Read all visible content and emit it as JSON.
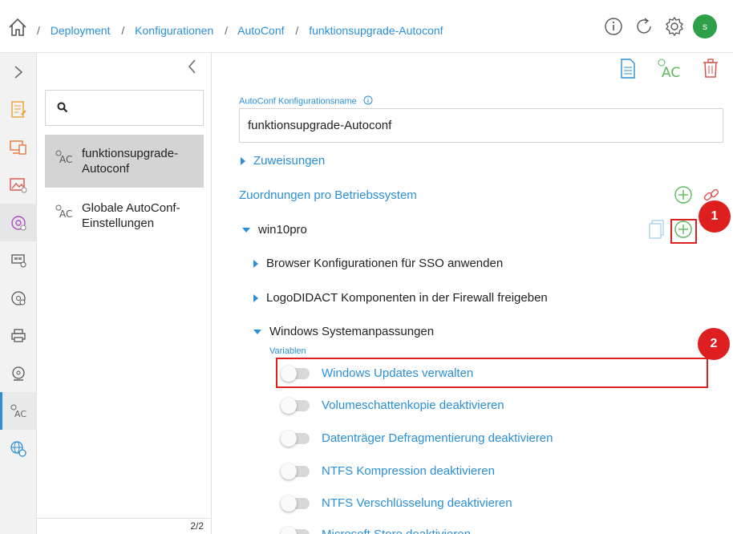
{
  "breadcrumb": {
    "items": [
      "Deployment",
      "Konfigurationen",
      "AutoConf",
      "funktionsupgrade-Autoconf"
    ],
    "separator": "/"
  },
  "header": {
    "icons": [
      "home-icon",
      "info-icon",
      "refresh-icon",
      "gear-icon"
    ],
    "avatar_initial": "s"
  },
  "rail": {
    "icons": [
      "chevron-right-icon",
      "document-edit-icon",
      "devices-icon",
      "image-deploy-icon",
      "gear-apps-icon",
      "network-icon",
      "disc-icon",
      "printer-icon",
      "webcam-disc-icon",
      "autoconf-icon",
      "globe-gear-icon"
    ]
  },
  "list": {
    "search_placeholder": "",
    "items": [
      {
        "label_line1": "funktionsupgrade-",
        "label_line2": "Autoconf",
        "selected": true
      },
      {
        "label_line1": "Globale AutoConf-",
        "label_line2": "Einstellungen",
        "selected": false
      }
    ],
    "pager": "2/2"
  },
  "form": {
    "name_label": "AutoConf Konfigurationsname",
    "name_value": "funktionsupgrade-Autoconf",
    "assignments": "Zuweisungen",
    "os_mapping": "Zuordnungen pro Betriebssystem",
    "os": "win10pro",
    "groups": [
      "Browser Konfigurationen für SSO anwenden",
      "LogoDIDACT Komponenten in der Firewall freigeben",
      "Windows Systemanpassungen"
    ],
    "variables_label": "Variablen",
    "toggles": [
      "Windows Updates verwalten",
      "Volumeschattenkopie deaktivieren",
      "Datenträger Defragmentierung deaktivieren",
      "NTFS Kompression deaktivieren",
      "NTFS Verschlüsselung deaktivieren",
      "Microsoft Store deaktivieren"
    ],
    "toolbar_ac_text": "AC",
    "list_ac_text": "AC"
  },
  "annotations": {
    "badge1": "1",
    "badge2": "2"
  },
  "colors": {
    "accent": "#2a8fd6",
    "green": "#5cb85c",
    "red": "#e01f1f",
    "orange": "#f0a030"
  }
}
